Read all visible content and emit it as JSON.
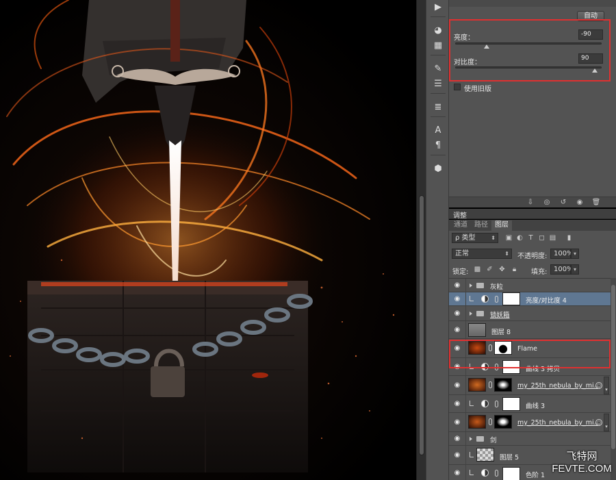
{
  "properties": {
    "auto_label": "自动",
    "brightness_label": "亮度：",
    "brightness_value": "-90",
    "brightness_level": 0.21,
    "contrast_label": "对比度：",
    "contrast_value": "90",
    "contrast_level": 0.95,
    "legacy_label": "使用旧版"
  },
  "panel": {
    "adjust_title": "调整",
    "tabs": [
      "通道",
      "路径",
      "图层"
    ],
    "filter_kind": "ρ 类型",
    "blend_mode": "正常",
    "opacity_label": "不透明度:",
    "opacity_value": "100%",
    "lock_label": "锁定:",
    "fill_label": "填充:",
    "fill_value": "100%"
  },
  "layers": [
    {
      "name": "灰粒",
      "kind": "group"
    },
    {
      "name": "亮度/对比度 4",
      "kind": "adjustment",
      "selected": true
    },
    {
      "name": "锁妖箱",
      "kind": "group"
    },
    {
      "name": "图层 8",
      "kind": "pixel"
    },
    {
      "name": "Flame",
      "kind": "pixel-mask"
    },
    {
      "name": "曲线 3 拷贝",
      "kind": "adjustment"
    },
    {
      "name": "my_25th_nebula_by_mi...",
      "kind": "pixel-mask"
    },
    {
      "name": "曲线 3",
      "kind": "adjustment"
    },
    {
      "name": "my_25th_nebula_by_mi...",
      "kind": "pixel-mask"
    },
    {
      "name": "剑",
      "kind": "group"
    },
    {
      "name": "图层 5",
      "kind": "pixel"
    },
    {
      "name": "色阶 1",
      "kind": "adjustment"
    }
  ],
  "tools": [
    "play-icon",
    "palette-icon",
    "grid-icon",
    "brush-tool-icon",
    "sliders-icon",
    "list-icon",
    "type-icon",
    "paragraph-icon",
    "cube-icon"
  ],
  "watermark": {
    "cn": "飞特网",
    "en": "FEVTE.COM"
  },
  "colors": {
    "highlight": "#e03030",
    "selected_row": "#5f7792",
    "panel": "#535353"
  }
}
